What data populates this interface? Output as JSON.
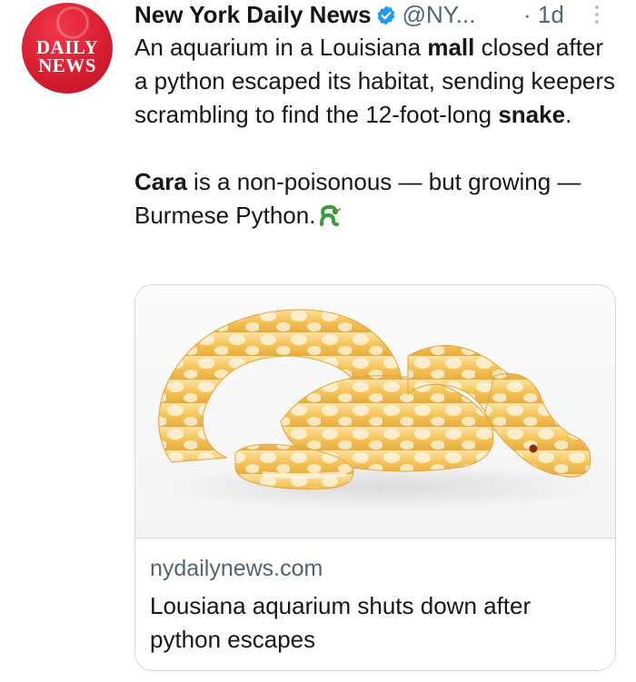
{
  "tweet": {
    "author_name": "New York Daily News",
    "handle": "@NY...",
    "separator": "·",
    "time": "1d",
    "avatar_text": [
      "DAILY",
      "NEWS"
    ],
    "text_p1": {
      "a": "An aquarium in a Louisiana ",
      "b": "mall",
      "c": " closed after a python escaped its habitat, sending keepers scrambling to find the 12-foot-long ",
      "d": "snake",
      "e": "."
    },
    "text_p2": {
      "a": "Cara",
      "b": " is a non-poisonous — but growing — Burmese Python."
    }
  },
  "card": {
    "domain": "nydailynews.com",
    "title": "Lousiana aquarium shuts down after python escapes",
    "image_icon": "albino-burmese-python-image"
  },
  "icons": {
    "verified": "verified-badge-icon",
    "more": "more-options-icon",
    "snake_emoji": "snake-emoji-icon"
  },
  "colors": {
    "brand_red": "#d81f32",
    "verified_blue": "#1d9bf0",
    "text_primary": "#14171a",
    "text_secondary": "#536471"
  }
}
